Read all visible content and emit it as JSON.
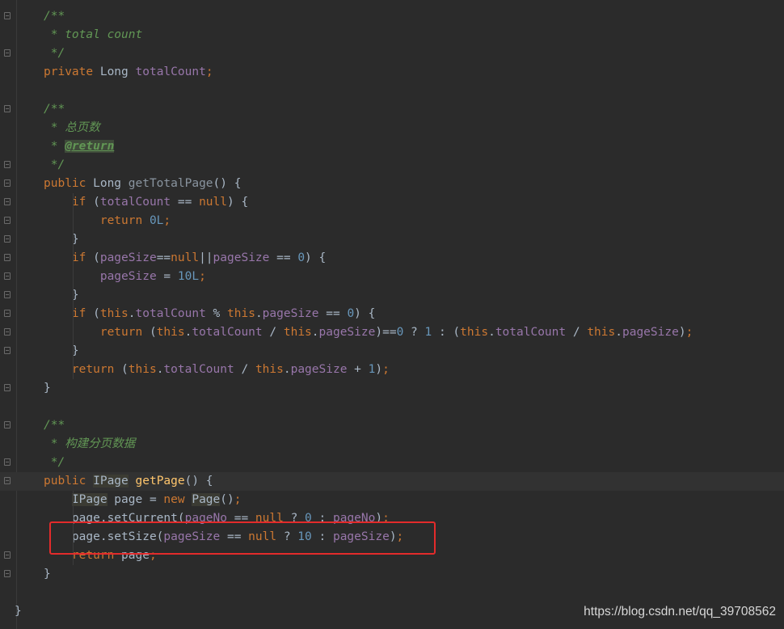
{
  "editor": {
    "lines": [
      {
        "segs": [
          {
            "t": "/**",
            "c": "doc"
          }
        ]
      },
      {
        "segs": [
          {
            "t": " * total count",
            "c": "doc"
          }
        ]
      },
      {
        "segs": [
          {
            "t": " */",
            "c": "doc"
          }
        ]
      },
      {
        "segs": [
          {
            "t": "private ",
            "c": "kw"
          },
          {
            "t": "Long "
          },
          {
            "t": "totalCount",
            "c": "fld"
          },
          {
            "t": ";",
            "c": "kw"
          }
        ]
      },
      {
        "segs": []
      },
      {
        "segs": [
          {
            "t": "/**",
            "c": "doc"
          }
        ]
      },
      {
        "segs": [
          {
            "t": " * 总页数",
            "c": "doc"
          }
        ]
      },
      {
        "segs": [
          {
            "t": " * ",
            "c": "doc"
          },
          {
            "t": "@return",
            "c": "doctag"
          }
        ]
      },
      {
        "segs": [
          {
            "t": " */",
            "c": "doc"
          }
        ]
      },
      {
        "segs": [
          {
            "t": "public ",
            "c": "kw"
          },
          {
            "t": "Long "
          },
          {
            "t": "getTotalPage",
            "c": "fnd"
          },
          {
            "t": "() {"
          }
        ]
      },
      {
        "segs": [
          {
            "t": "    if ",
            "c": "kw"
          },
          {
            "t": "("
          },
          {
            "t": "totalCount",
            "c": "fld"
          },
          {
            "t": " == "
          },
          {
            "t": "null",
            "c": "kw"
          },
          {
            "t": ") {"
          }
        ]
      },
      {
        "segs": [
          {
            "t": "        return ",
            "c": "kw"
          },
          {
            "t": "0L",
            "c": "num"
          },
          {
            "t": ";",
            "c": "kw"
          }
        ]
      },
      {
        "segs": [
          {
            "t": "    }"
          }
        ]
      },
      {
        "segs": [
          {
            "t": "    if ",
            "c": "kw"
          },
          {
            "t": "("
          },
          {
            "t": "pageSize",
            "c": "fld"
          },
          {
            "t": "=="
          },
          {
            "t": "null",
            "c": "kw"
          },
          {
            "t": "||"
          },
          {
            "t": "pageSize",
            "c": "fld"
          },
          {
            "t": " == "
          },
          {
            "t": "0",
            "c": "num"
          },
          {
            "t": ") {"
          }
        ]
      },
      {
        "segs": [
          {
            "t": "        "
          },
          {
            "t": "pageSize",
            "c": "fld"
          },
          {
            "t": " = "
          },
          {
            "t": "10L",
            "c": "num"
          },
          {
            "t": ";",
            "c": "kw"
          }
        ]
      },
      {
        "segs": [
          {
            "t": "    }"
          }
        ]
      },
      {
        "segs": [
          {
            "t": "    if ",
            "c": "kw"
          },
          {
            "t": "("
          },
          {
            "t": "this",
            "c": "kw"
          },
          {
            "t": "."
          },
          {
            "t": "totalCount",
            "c": "fld"
          },
          {
            "t": " % "
          },
          {
            "t": "this",
            "c": "kw"
          },
          {
            "t": "."
          },
          {
            "t": "pageSize",
            "c": "fld"
          },
          {
            "t": " == "
          },
          {
            "t": "0",
            "c": "num"
          },
          {
            "t": ") {"
          }
        ]
      },
      {
        "segs": [
          {
            "t": "        return ",
            "c": "kw"
          },
          {
            "t": "("
          },
          {
            "t": "this",
            "c": "kw"
          },
          {
            "t": "."
          },
          {
            "t": "totalCount",
            "c": "fld"
          },
          {
            "t": " / "
          },
          {
            "t": "this",
            "c": "kw"
          },
          {
            "t": "."
          },
          {
            "t": "pageSize",
            "c": "fld"
          },
          {
            "t": ")=="
          },
          {
            "t": "0",
            "c": "num"
          },
          {
            "t": " ? "
          },
          {
            "t": "1",
            "c": "num"
          },
          {
            "t": " : ("
          },
          {
            "t": "this",
            "c": "kw"
          },
          {
            "t": "."
          },
          {
            "t": "totalCount",
            "c": "fld"
          },
          {
            "t": " / "
          },
          {
            "t": "this",
            "c": "kw"
          },
          {
            "t": "."
          },
          {
            "t": "pageSize",
            "c": "fld"
          },
          {
            "t": ")"
          },
          {
            "t": ";",
            "c": "kw"
          }
        ]
      },
      {
        "segs": [
          {
            "t": "    }"
          }
        ]
      },
      {
        "segs": [
          {
            "t": "    return ",
            "c": "kw"
          },
          {
            "t": "("
          },
          {
            "t": "this",
            "c": "kw"
          },
          {
            "t": "."
          },
          {
            "t": "totalCount",
            "c": "fld"
          },
          {
            "t": " / "
          },
          {
            "t": "this",
            "c": "kw"
          },
          {
            "t": "."
          },
          {
            "t": "pageSize",
            "c": "fld"
          },
          {
            "t": " + "
          },
          {
            "t": "1",
            "c": "num"
          },
          {
            "t": ")"
          },
          {
            "t": ";",
            "c": "kw"
          }
        ]
      },
      {
        "segs": [
          {
            "t": "}"
          }
        ]
      },
      {
        "segs": []
      },
      {
        "segs": [
          {
            "t": "/**",
            "c": "doc"
          }
        ]
      },
      {
        "segs": [
          {
            "t": " * 构建分页数据",
            "c": "doc"
          }
        ]
      },
      {
        "segs": [
          {
            "t": " */",
            "c": "doc"
          }
        ]
      },
      {
        "current": true,
        "segs": [
          {
            "t": "public ",
            "c": "kw"
          },
          {
            "t": "IPage",
            "c": "typehl"
          },
          {
            "t": " "
          },
          {
            "t": "getPage",
            "c": "fn"
          },
          {
            "t": "() {"
          }
        ]
      },
      {
        "segs": [
          {
            "t": "    "
          },
          {
            "t": "IPage",
            "c": "typehl"
          },
          {
            "t": " page = "
          },
          {
            "t": "new ",
            "c": "kw"
          },
          {
            "t": "Page",
            "c": "typehl"
          },
          {
            "t": "()"
          },
          {
            "t": ";",
            "c": "kw"
          }
        ]
      },
      {
        "segs": [
          {
            "t": "    page.setCurrent("
          },
          {
            "t": "pageNo",
            "c": "fld"
          },
          {
            "t": " == "
          },
          {
            "t": "null",
            "c": "kw"
          },
          {
            "t": " ? "
          },
          {
            "t": "0",
            "c": "num"
          },
          {
            "t": " : "
          },
          {
            "t": "pageNo",
            "c": "fld"
          },
          {
            "t": ")"
          },
          {
            "t": ";",
            "c": "kw"
          }
        ]
      },
      {
        "segs": [
          {
            "t": "    page.setSize("
          },
          {
            "t": "pageSize",
            "c": "fld"
          },
          {
            "t": " == "
          },
          {
            "t": "null",
            "c": "kw"
          },
          {
            "t": " ? "
          },
          {
            "t": "10",
            "c": "num"
          },
          {
            "t": " : "
          },
          {
            "t": "pageSize",
            "c": "fld"
          },
          {
            "t": ")"
          },
          {
            "t": ";",
            "c": "kw"
          }
        ]
      },
      {
        "segs": [
          {
            "t": "    return ",
            "c": "kw"
          },
          {
            "t": "page"
          },
          {
            "t": ";",
            "c": "kw"
          }
        ]
      },
      {
        "segs": [
          {
            "t": "}"
          }
        ]
      },
      {
        "segs": []
      },
      {
        "outer": true,
        "segs": [
          {
            "t": "}"
          }
        ]
      }
    ]
  },
  "colors": {
    "keyword": "#cc7832",
    "field": "#9876aa",
    "number": "#6897bb",
    "method": "#ffc66d",
    "doc": "#629755",
    "text": "#a9b7c6",
    "highlight_box": "#e32b2b"
  },
  "watermark": "https://blog.csdn.net/qq_39708562"
}
